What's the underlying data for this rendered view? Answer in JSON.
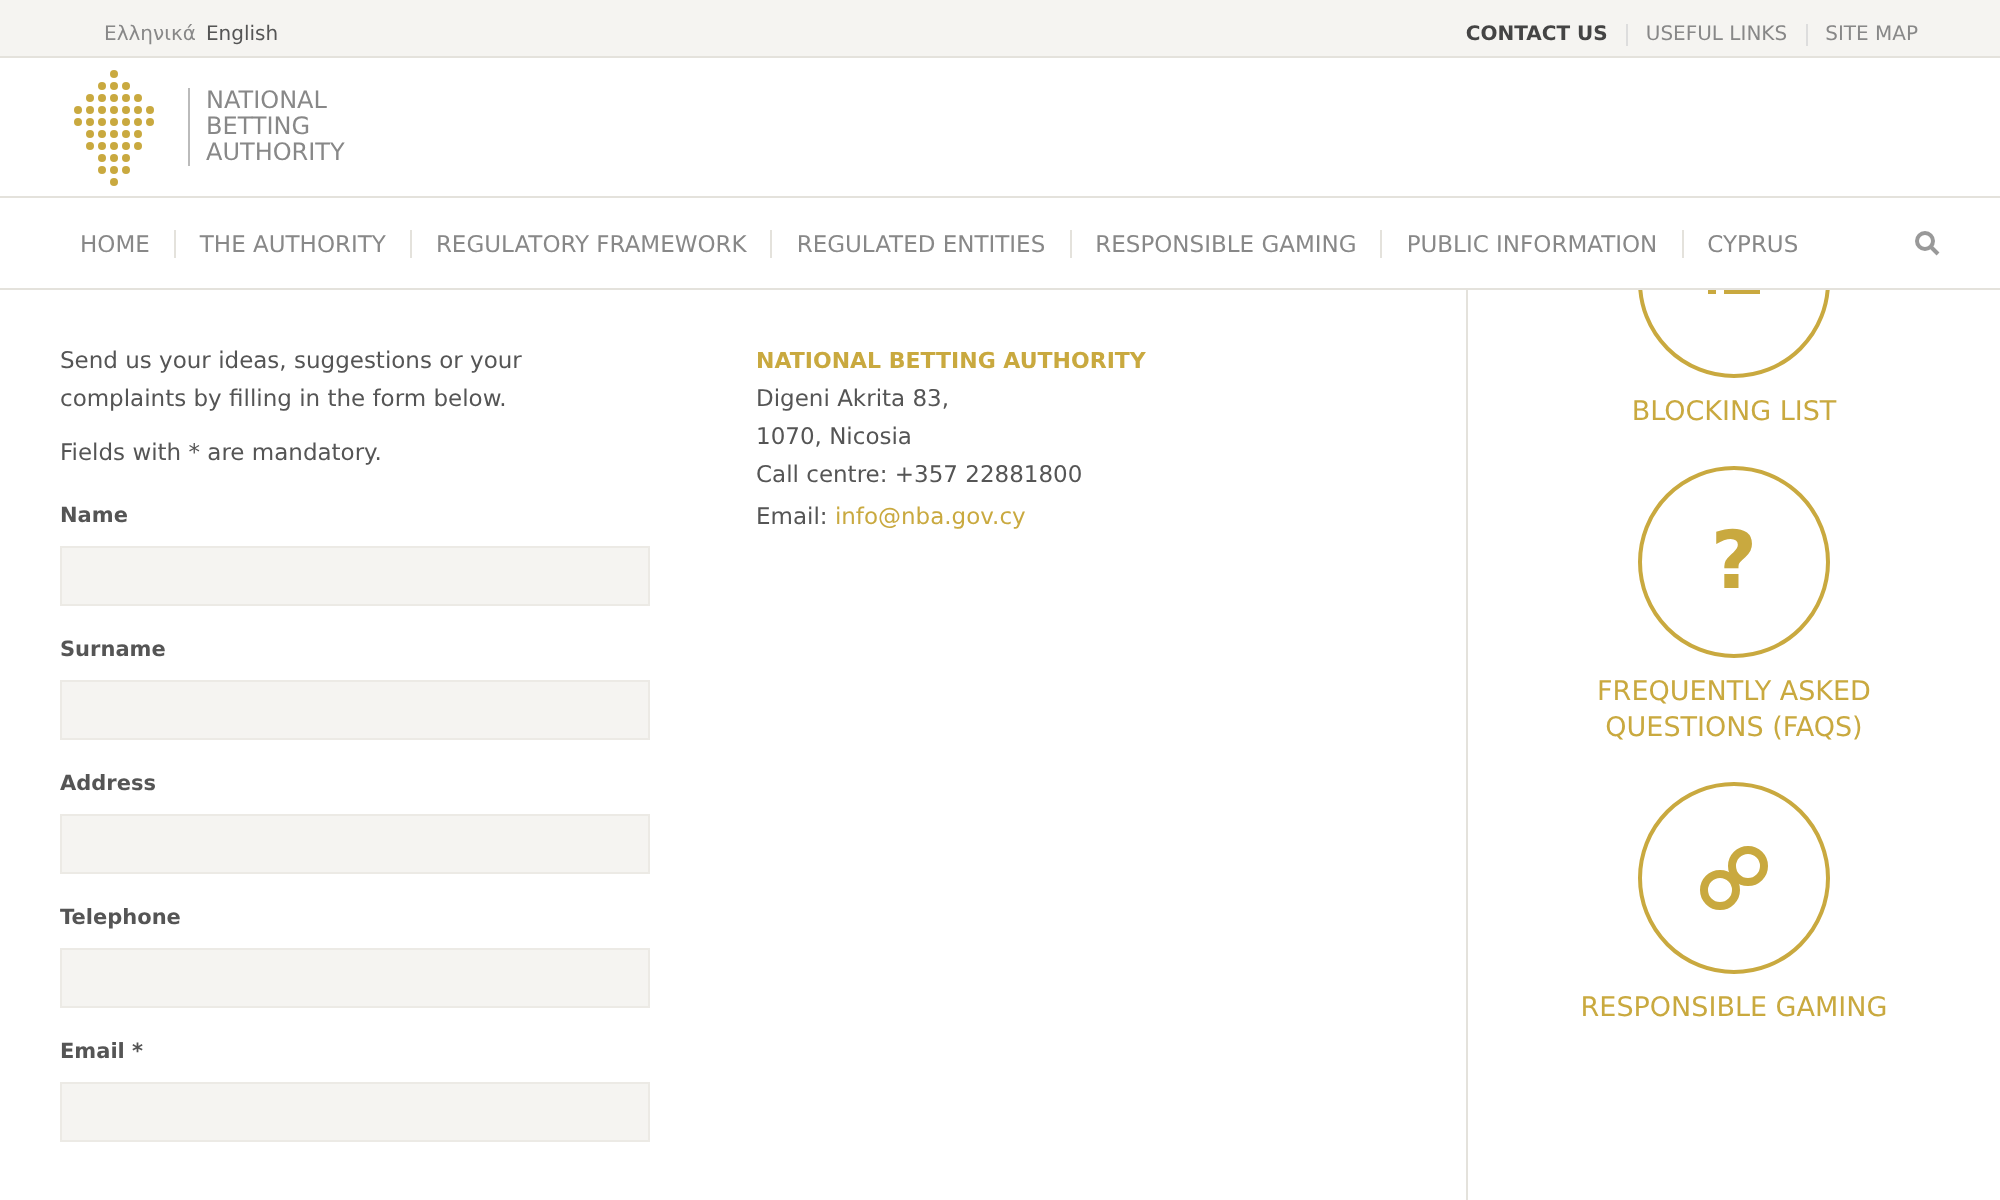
{
  "languages": [
    {
      "label": "Ελληνικά",
      "selected": false
    },
    {
      "label": "English",
      "selected": true
    }
  ],
  "top_links": [
    {
      "label": "CONTACT US",
      "selected": true
    },
    {
      "label": "USEFUL LINKS",
      "selected": false
    },
    {
      "label": "SITE MAP",
      "selected": false
    }
  ],
  "logo": {
    "lines": [
      "NATIONAL",
      "BETTING",
      "AUTHORITY"
    ]
  },
  "nav": [
    "HOME",
    "THE AUTHORITY",
    "REGULATORY FRAMEWORK",
    "REGULATED ENTITIES",
    "RESPONSIBLE GAMING",
    "PUBLIC INFORMATION",
    "CYPRUS"
  ],
  "intro": "Send us your ideas, suggestions or your complaints by filling in the form below.",
  "mandatory_note": "Fields with * are mandatory.",
  "form_fields": [
    {
      "label": "Name"
    },
    {
      "label": "Surname"
    },
    {
      "label": "Address"
    },
    {
      "label": "Telephone"
    },
    {
      "label": "Email *"
    }
  ],
  "contact": {
    "title": "NATIONAL BETTING AUTHORITY",
    "lines": [
      "Digeni Akrita 83,",
      "1070, Nicosia",
      "Call centre: +357 22881800"
    ],
    "email_label": "Email:",
    "email": "info@nba.gov.cy"
  },
  "sidebar": [
    {
      "kind": "list",
      "label": "BLOCKING LIST"
    },
    {
      "kind": "question",
      "glyph": "?",
      "label": "FREQUENTLY ASKED QUESTIONS (FAQS)"
    },
    {
      "kind": "gaming",
      "label": "RESPONSIBLE GAMING"
    }
  ]
}
